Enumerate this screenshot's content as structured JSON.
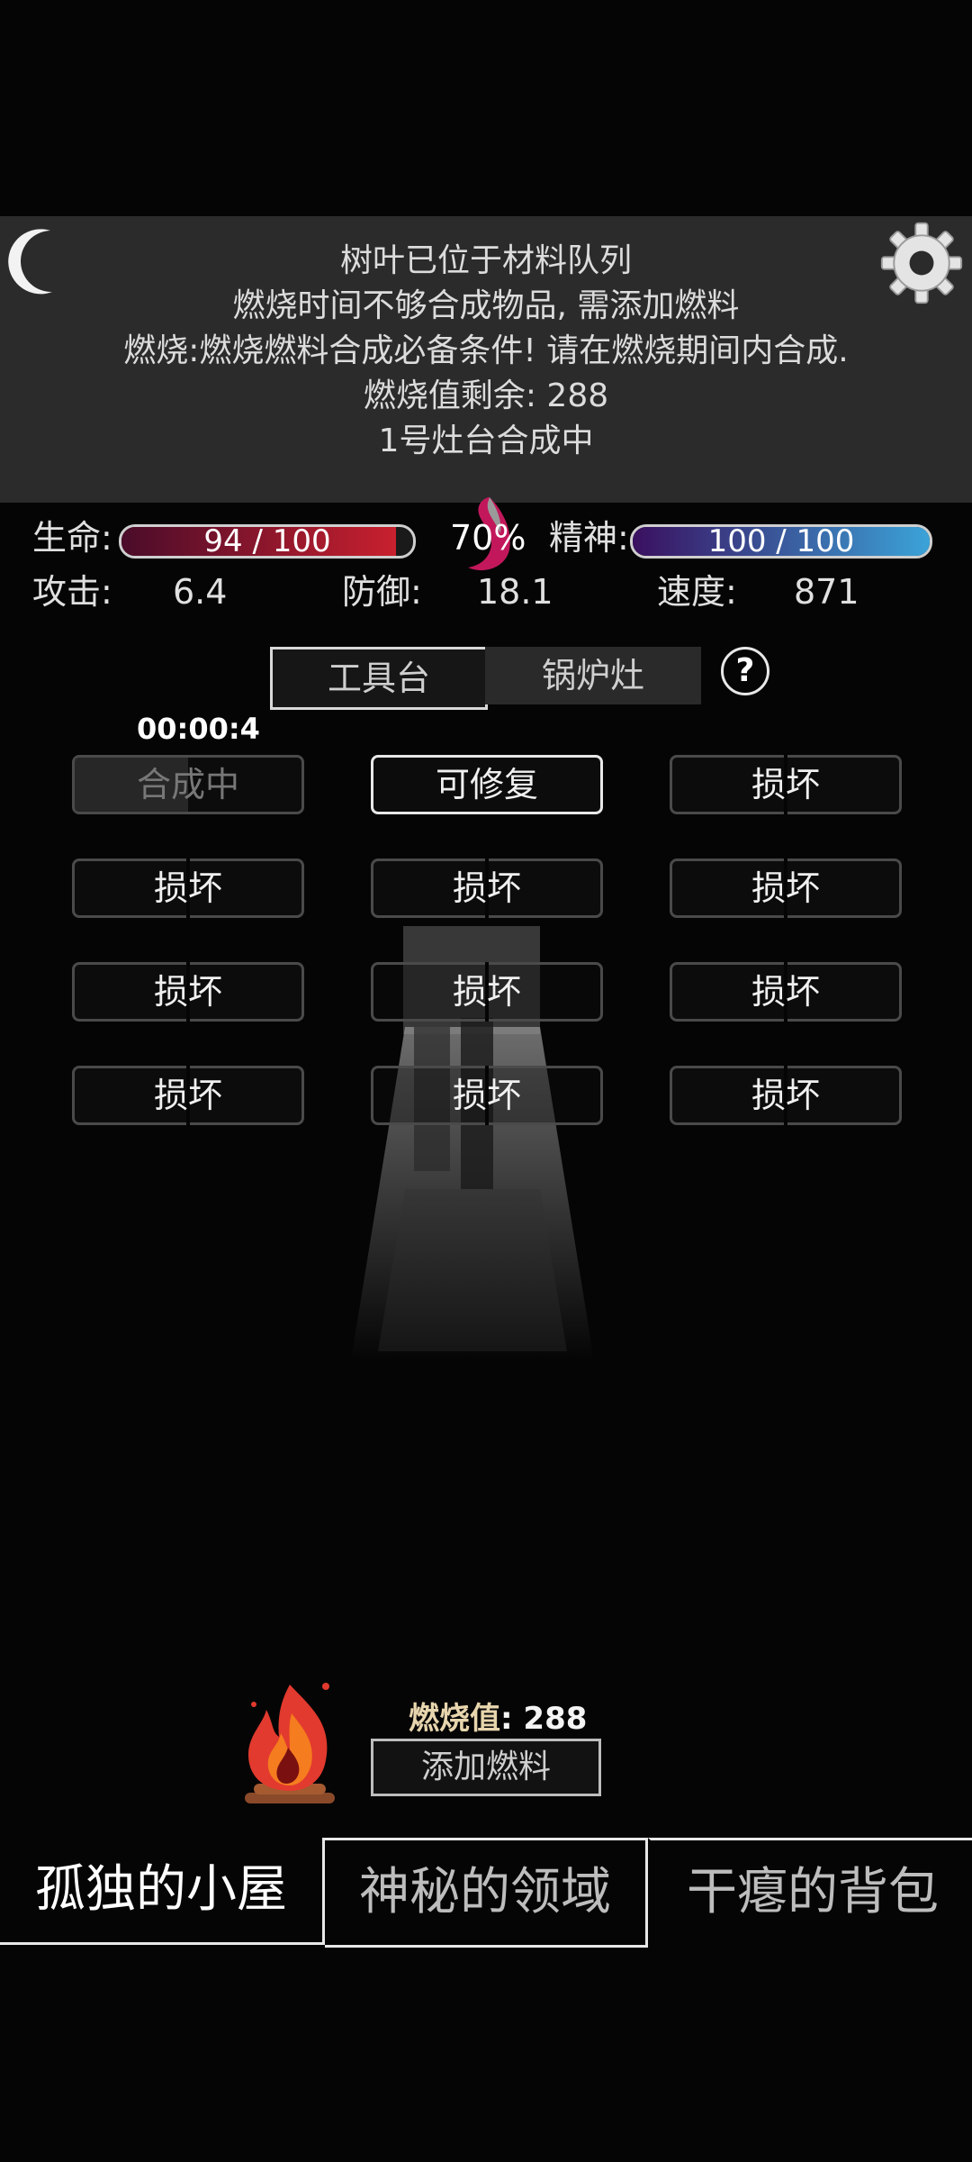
{
  "messages": [
    "树叶已位于材料队列",
    "燃烧时间不够合成物品, 需添加燃料",
    "燃烧:燃烧燃料合成必备条件! 请在燃烧期间内合成.",
    "燃烧值剩余: 288",
    "1号灶台合成中"
  ],
  "stats": {
    "hp_label": "生命:",
    "hp_text": "94 / 100",
    "hp_value": 94,
    "hp_max": 100,
    "hunger_text": "70%",
    "spirit_label": "精神:",
    "spirit_text": "100 / 100",
    "spirit_value": 100,
    "spirit_max": 100,
    "attack_label": "攻击:",
    "attack_value": "6.4",
    "defense_label": "防御:",
    "defense_value": "18.1",
    "speed_label": "速度:",
    "speed_value": "871"
  },
  "tabs": {
    "workbench": "工具台",
    "boiler": "锅炉灶",
    "help": "?"
  },
  "timer": "00:00:4",
  "slots": [
    {
      "label": "合成中",
      "state": "crafting",
      "progress": 0.5
    },
    {
      "label": "可修复",
      "state": "repairable"
    },
    {
      "label": "损坏",
      "state": "broken"
    },
    {
      "label": "损坏",
      "state": "broken"
    },
    {
      "label": "损坏",
      "state": "broken"
    },
    {
      "label": "损坏",
      "state": "broken"
    },
    {
      "label": "损坏",
      "state": "broken"
    },
    {
      "label": "损坏",
      "state": "broken"
    },
    {
      "label": "损坏",
      "state": "broken"
    },
    {
      "label": "损坏",
      "state": "broken"
    },
    {
      "label": "损坏",
      "state": "broken"
    },
    {
      "label": "损坏",
      "state": "broken"
    }
  ],
  "fuel": {
    "burn_label": "燃烧值",
    "burn_value": ": 288",
    "add_fuel": "添加燃料"
  },
  "nav": {
    "cabin": "孤独的小屋",
    "domain": "神秘的领域",
    "bag": "干瘪的背包"
  },
  "colors": {
    "hp": "#c8202e",
    "spirit": "#3ba3d8",
    "panel": "#2b2b2c"
  },
  "icons": [
    "moon-icon",
    "gear-icon",
    "hunger-icon",
    "help-icon",
    "campfire-icon"
  ]
}
